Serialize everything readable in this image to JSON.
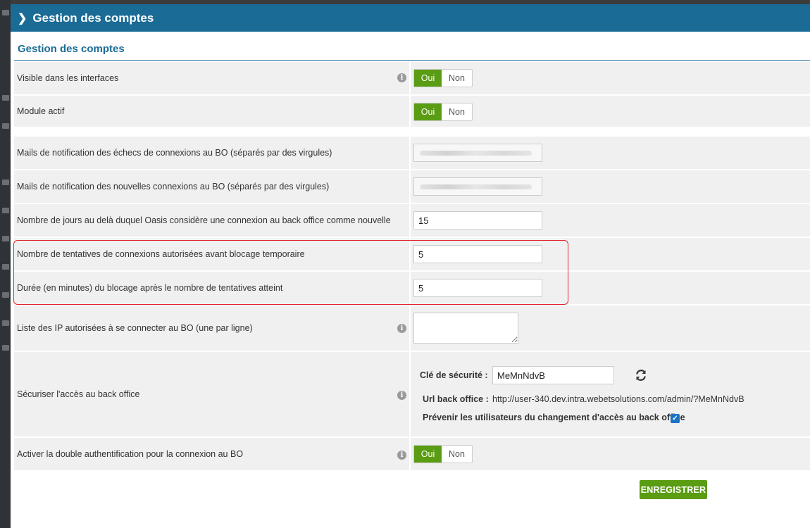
{
  "header": {
    "title": "Gestion des comptes"
  },
  "section": {
    "title": "Gestion des comptes"
  },
  "rows": {
    "visible": {
      "label": "Visible dans les interfaces",
      "yes": "Oui",
      "no": "Non",
      "value": "Oui"
    },
    "module": {
      "label": "Module actif",
      "yes": "Oui",
      "no": "Non",
      "value": "Oui"
    },
    "mail_fail": {
      "label": "Mails de notification des échecs de connexions au BO (séparés par des virgules)"
    },
    "mail_new": {
      "label": "Mails de notification des nouvelles connexions au BO (séparés par des virgules)"
    },
    "days": {
      "label": "Nombre de jours au delà duquel Oasis considère une connexion au back office comme nouvelle",
      "value": "15"
    },
    "attempts": {
      "label": "Nombre de tentatives de connexions autorisées avant blocage temporaire",
      "value": "5"
    },
    "duration": {
      "label": "Durée (en minutes) du blocage après le nombre de tentatives atteint",
      "value": "5"
    },
    "ip": {
      "label": "Liste des IP autorisées à se connecter au BO (une par ligne)"
    },
    "secure": {
      "label": "Sécuriser l'accès au back office",
      "key_label": "Clé de sécurité :",
      "key_value": "MeMnNdvB",
      "url_label": "Url back office :",
      "url_value": "http://user-340.dev.intra.webetsolutions.com/admin/?MeMnNdvB",
      "notify_label": "Prévenir les utilisateurs du changement d'accès au back office",
      "notify_checked": true
    },
    "twofa": {
      "label": "Activer la double authentification pour la connexion au BO",
      "yes": "Oui",
      "no": "Non",
      "value": "Oui"
    }
  },
  "actions": {
    "save": "ENREGISTRER"
  },
  "icons": {
    "info": "info-icon",
    "refresh": "refresh-icon",
    "checkbox": "checkbox-checked-icon",
    "chevron": "chevron-right-icon"
  },
  "colors": {
    "header": "#1a6b96",
    "accent": "#5a9c12",
    "highlight": "#e0252a"
  }
}
